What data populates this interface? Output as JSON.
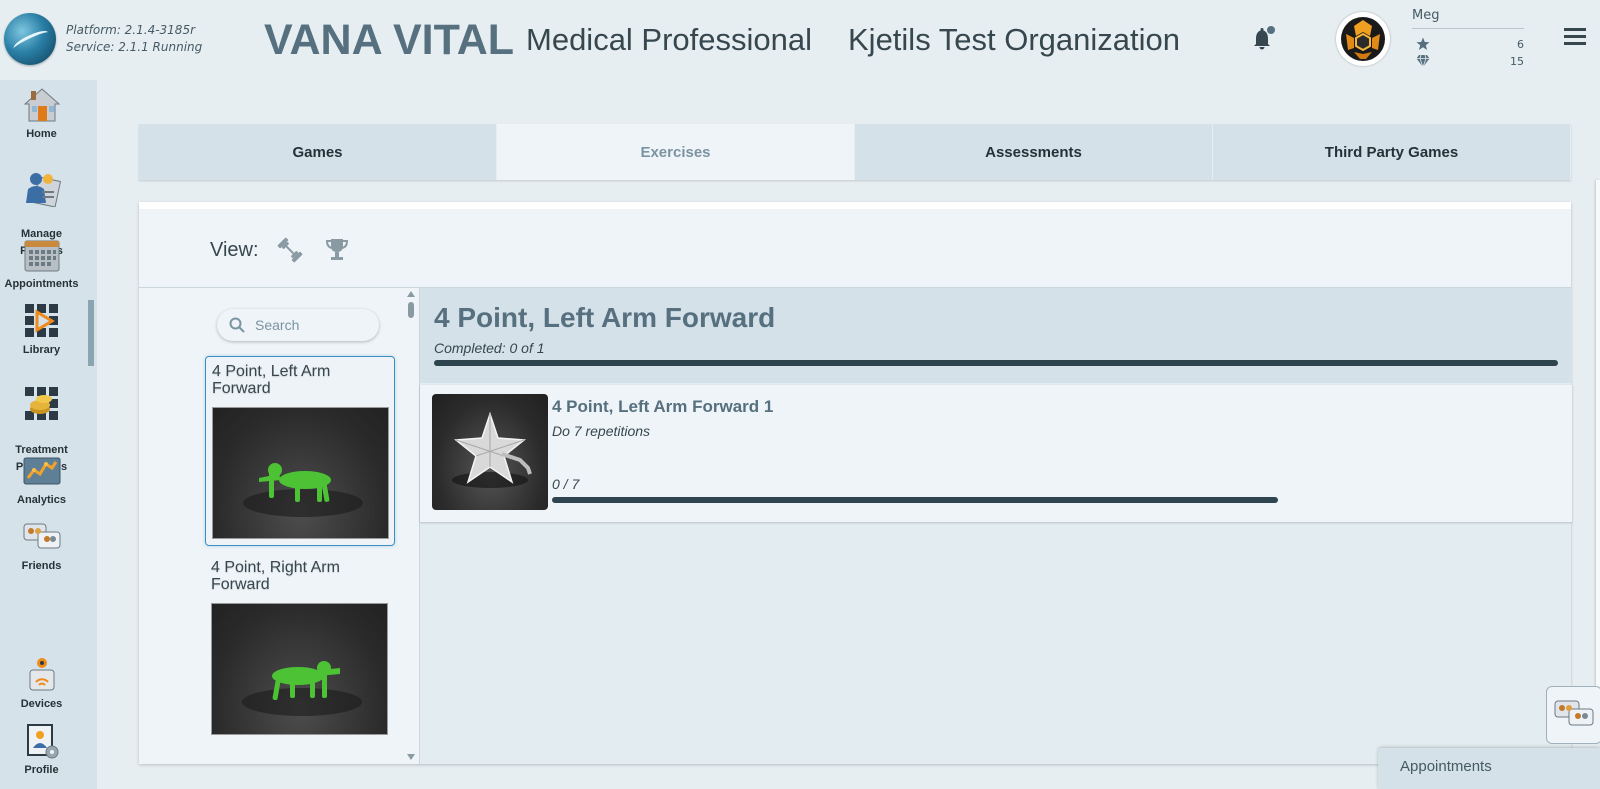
{
  "header": {
    "platform_line": "Platform: 2.1.4-3185r",
    "service_line": "Service:   2.1.1 Running",
    "brand": "VANA VITAL",
    "role": "Medical Professional",
    "organization": "Kjetils Test Organization",
    "user": {
      "name": "Meg",
      "stars": "6",
      "gems": "15"
    }
  },
  "sidebar": {
    "items": [
      {
        "label": "Home",
        "icon": "home-icon"
      },
      {
        "label": "Manage\nPatients",
        "icon": "manage-patients-icon"
      },
      {
        "label": "Appointments",
        "icon": "calendar-icon"
      },
      {
        "label": "Library",
        "icon": "library-icon"
      },
      {
        "label": "Treatment\nPrograms",
        "icon": "treatment-programs-icon"
      },
      {
        "label": "Analytics",
        "icon": "analytics-icon"
      },
      {
        "label": "Friends",
        "icon": "friends-icon"
      },
      {
        "label": "Devices",
        "icon": "devices-icon"
      },
      {
        "label": "Profile",
        "icon": "profile-icon"
      }
    ],
    "active": "Library"
  },
  "tabs": [
    {
      "label": "Games"
    },
    {
      "label": "Exercises"
    },
    {
      "label": "Assessments"
    },
    {
      "label": "Third Party Games"
    }
  ],
  "active_tab": "Exercises",
  "view": {
    "label": "View:",
    "icons": [
      "dumbbell-icon",
      "trophy-icon"
    ]
  },
  "search": {
    "placeholder": "Search"
  },
  "exercise_list": [
    {
      "title": "4 Point, Left Arm Forward",
      "selected": true
    },
    {
      "title": "4 Point, Right Arm Forward",
      "selected": false
    }
  ],
  "detail": {
    "title": "4 Point, Left Arm Forward",
    "completed": "Completed: 0 of 1",
    "progress": 0,
    "items": [
      {
        "title": "4 Point, Left Arm Forward 1",
        "description": "Do 7 repetitions",
        "count": "0 / 7",
        "progress": 0
      }
    ]
  },
  "floating": {
    "appointments_tab": "Appointments"
  },
  "colors": {
    "accent_blue": "#3f8fc4",
    "progress_track": "#2e444e",
    "figure_green": "#4cc234"
  }
}
